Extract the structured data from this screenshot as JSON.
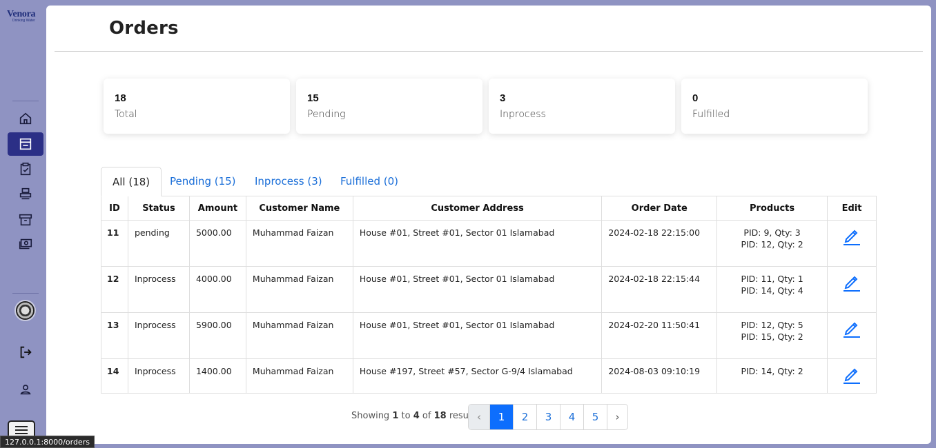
{
  "app": {
    "logo_text": "Venora",
    "logo_sub": "Drinking Water",
    "status_url": "127.0.0.1:8000/orders"
  },
  "sidebar": {
    "items": [
      {
        "icon": "home-icon",
        "active": false
      },
      {
        "icon": "shop-icon",
        "active": true
      },
      {
        "icon": "clipboard-check-icon",
        "active": false
      },
      {
        "icon": "printer-icon",
        "active": false
      },
      {
        "icon": "archive-icon",
        "active": false
      },
      {
        "icon": "cash-icon",
        "active": false
      }
    ]
  },
  "page": {
    "title": "Orders"
  },
  "stats": [
    {
      "count": "18",
      "label": "Total"
    },
    {
      "count": "15",
      "label": "Pending"
    },
    {
      "count": "3",
      "label": "Inprocess"
    },
    {
      "count": "0",
      "label": "Fulfilled"
    }
  ],
  "tabs": [
    {
      "label": "All (18)",
      "active": true
    },
    {
      "label": "Pending (15)",
      "active": false
    },
    {
      "label": "Inprocess (3)",
      "active": false
    },
    {
      "label": "Fulfilled (0)",
      "active": false
    }
  ],
  "table": {
    "headers": [
      "ID",
      "Status",
      "Amount",
      "Customer Name",
      "Customer Address",
      "Order Date",
      "Products",
      "Edit"
    ],
    "rows": [
      {
        "id": "11",
        "status": "pending",
        "amount": "5000.00",
        "customer": "Muhammad Faizan",
        "address": "House #01, Street #01, Sector 01 Islamabad",
        "date": "2024-02-18 22:15:00",
        "products": [
          "PID: 9, Qty: 3",
          "PID: 12, Qty: 2"
        ]
      },
      {
        "id": "12",
        "status": "Inprocess",
        "amount": "4000.00",
        "customer": "Muhammad Faizan",
        "address": "House #01, Street #01, Sector 01 Islamabad",
        "date": "2024-02-18 22:15:44",
        "products": [
          "PID: 11, Qty: 1",
          "PID: 14, Qty: 4"
        ]
      },
      {
        "id": "13",
        "status": "Inprocess",
        "amount": "5900.00",
        "customer": "Muhammad Faizan",
        "address": "House #01, Street #01, Sector 01 Islamabad",
        "date": "2024-02-20 11:50:41",
        "products": [
          "PID: 12, Qty: 5",
          "PID: 15, Qty: 2"
        ]
      },
      {
        "id": "14",
        "status": "Inprocess",
        "amount": "1400.00",
        "customer": "Muhammad Faizan",
        "address": "House #197, Street #57, Sector G-9/4 Islamabad",
        "date": "2024-08-03 09:10:19",
        "products": [
          "PID: 14, Qty: 2"
        ]
      }
    ]
  },
  "pagination": {
    "showing_prefix": "Showing",
    "from": "1",
    "to_word": "to",
    "to": "4",
    "of_word": "of",
    "total": "18",
    "suffix": "results",
    "prev": "‹",
    "pages": [
      "1",
      "2",
      "3",
      "4",
      "5"
    ],
    "current": "1",
    "next": "›"
  },
  "colors": {
    "background": "#8f93c2",
    "active_nav": "#2b2f86",
    "link": "#1a6ed8",
    "primary": "#0d6efd"
  }
}
